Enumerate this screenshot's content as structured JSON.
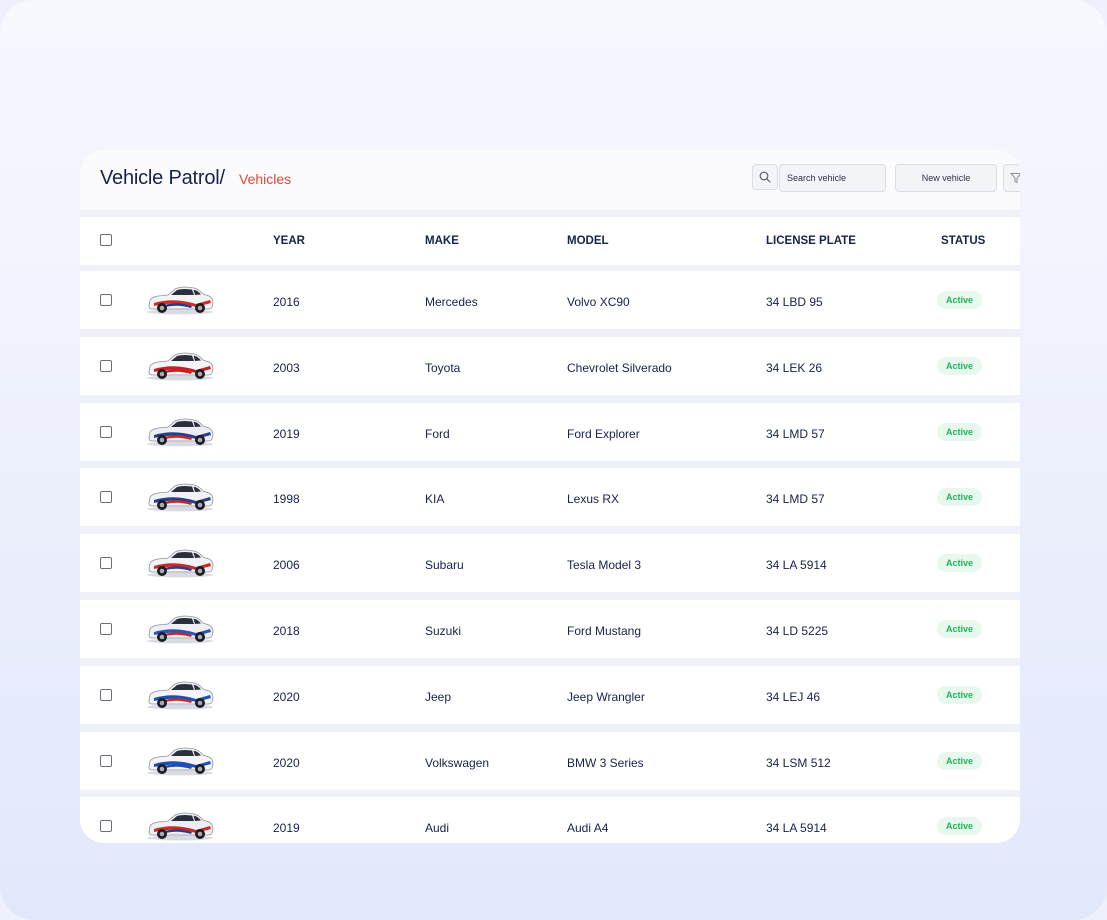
{
  "header": {
    "title": "Vehicle Patrol/",
    "breadcrumb": "Vehicles",
    "search_placeholder": "Search vehicle",
    "new_vehicle_label": "New vehicle"
  },
  "table": {
    "columns": [
      "YEAR",
      "MAKE",
      "MODEL",
      "LICENSE PLATE",
      "STATUS"
    ],
    "rows": [
      {
        "year": "2016",
        "make": "Mercedes",
        "model": "Volvo XC90",
        "plate": "34 LBD 95",
        "status": "Active"
      },
      {
        "year": "2003",
        "make": "Toyota",
        "model": "Chevrolet Silverado",
        "plate": "34 LEK 26",
        "status": "Active"
      },
      {
        "year": "2019",
        "make": "Ford",
        "model": "Ford Explorer",
        "plate": "34 LMD 57",
        "status": "Active"
      },
      {
        "year": "1998",
        "make": "KIA",
        "model": "Lexus RX",
        "plate": "34 LMD 57",
        "status": "Active"
      },
      {
        "year": "2006",
        "make": "Subaru",
        "model": "Tesla Model 3",
        "plate": "34 LA 5914",
        "status": "Active"
      },
      {
        "year": "2018",
        "make": "Suzuki",
        "model": "Ford Mustang",
        "plate": "34 LD 5225",
        "status": "Active"
      },
      {
        "year": "2020",
        "make": "Jeep",
        "model": "Jeep Wrangler",
        "plate": "34 LEJ 46",
        "status": "Active"
      },
      {
        "year": "2020",
        "make": "Volkswagen",
        "model": "BMW 3 Series",
        "plate": "34 LSM 512",
        "status": "Active"
      },
      {
        "year": "2019",
        "make": "Audi",
        "model": "Audi A4",
        "plate": "34 LA 5914",
        "status": "Active"
      }
    ]
  },
  "icons": {
    "search": "search-icon",
    "filter": "filter-icon",
    "vehicle": "vehicle-photo"
  },
  "colors": {
    "title": "#17224d",
    "breadcrumb": "#e0473c",
    "status_text": "#1fb35b",
    "status_bg": "#e9f8ef"
  }
}
